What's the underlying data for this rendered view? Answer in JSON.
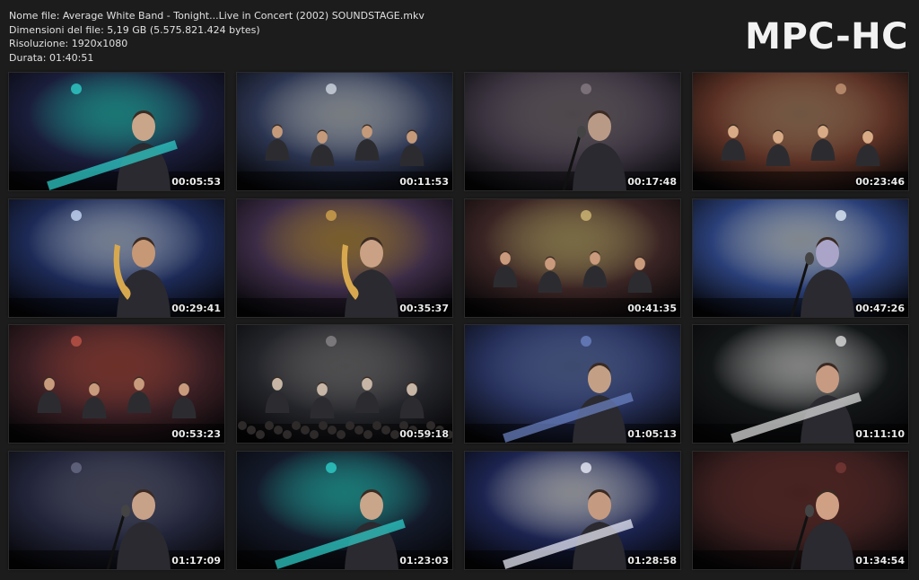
{
  "file_info": {
    "name_line": "Nome file: Average White Band - Tonight...Live in Concert (2002) SOUNDSTAGE.mkv",
    "size_line": "Dimensioni del file: 5,19 GB (5.575.821.424 bytes)",
    "resolution_line": "Risoluzione: 1920x1080",
    "duration_line": "Durata: 01:40:51"
  },
  "logo": "MPC-HC",
  "thumbnails": [
    {
      "time": "00:05:53",
      "scene": "guitarist-and-interview",
      "bg": "#1a1d3a",
      "accent": "#2fd6d0",
      "skin": "#c9a58a"
    },
    {
      "time": "00:11:53",
      "scene": "band-on-stage",
      "bg": "#2b3450",
      "accent": "#d7dfe8",
      "skin": "#c49a7a"
    },
    {
      "time": "00:17:48",
      "scene": "singer-closeup-overlay",
      "bg": "#3b3440",
      "accent": "#8a7f86",
      "skin": "#b89a86"
    },
    {
      "time": "00:23:46",
      "scene": "band-on-stage-warm",
      "bg": "#5a3024",
      "accent": "#c99b78",
      "skin": "#d8ab86"
    },
    {
      "time": "00:29:41",
      "scene": "saxophonist-blue",
      "bg": "#1d2a56",
      "accent": "#cfe0ff",
      "skin": "#c69875"
    },
    {
      "time": "00:35:37",
      "scene": "saxophonist-purple",
      "bg": "#3c2c46",
      "accent": "#d8a84e",
      "skin": "#caa185"
    },
    {
      "time": "00:41:35",
      "scene": "horn-section",
      "bg": "#3a2424",
      "accent": "#d8c07a",
      "skin": "#c99a7b"
    },
    {
      "time": "00:47:26",
      "scene": "singer-spotlight",
      "bg": "#2a3f78",
      "accent": "#e8f4ff",
      "skin": "#a9a4c8"
    },
    {
      "time": "00:53:23",
      "scene": "wide-stage-red",
      "bg": "#3a1f24",
      "accent": "#c4574a",
      "skin": "#c99b7d"
    },
    {
      "time": "00:59:18",
      "scene": "wide-audience",
      "bg": "#24252a",
      "accent": "#8c8a8c",
      "skin": "#c7b6a6"
    },
    {
      "time": "01:05:13",
      "scene": "guitarist-blue-screen",
      "bg": "#26305a",
      "accent": "#6e86c8",
      "skin": "#c3a085"
    },
    {
      "time": "01:11:10",
      "scene": "guitarist-dark",
      "bg": "#131617",
      "accent": "#e6e6e6",
      "skin": "#c69b82"
    },
    {
      "time": "01:17:09",
      "scene": "singer-mic-closeup",
      "bg": "#22253a",
      "accent": "#6c6f8a",
      "skin": "#c8a189"
    },
    {
      "time": "01:23:03",
      "scene": "guitarist-and-interview-2",
      "bg": "#141a2a",
      "accent": "#2fd6d0",
      "skin": "#c9a58a"
    },
    {
      "time": "01:28:58",
      "scene": "bass-player-blue",
      "bg": "#1c2450",
      "accent": "#f2f4ff",
      "skin": "#c49a80"
    },
    {
      "time": "01:34:54",
      "scene": "singer-red-curtain",
      "bg": "#3a1e1e",
      "accent": "#7a3a36",
      "skin": "#d0a085"
    }
  ]
}
